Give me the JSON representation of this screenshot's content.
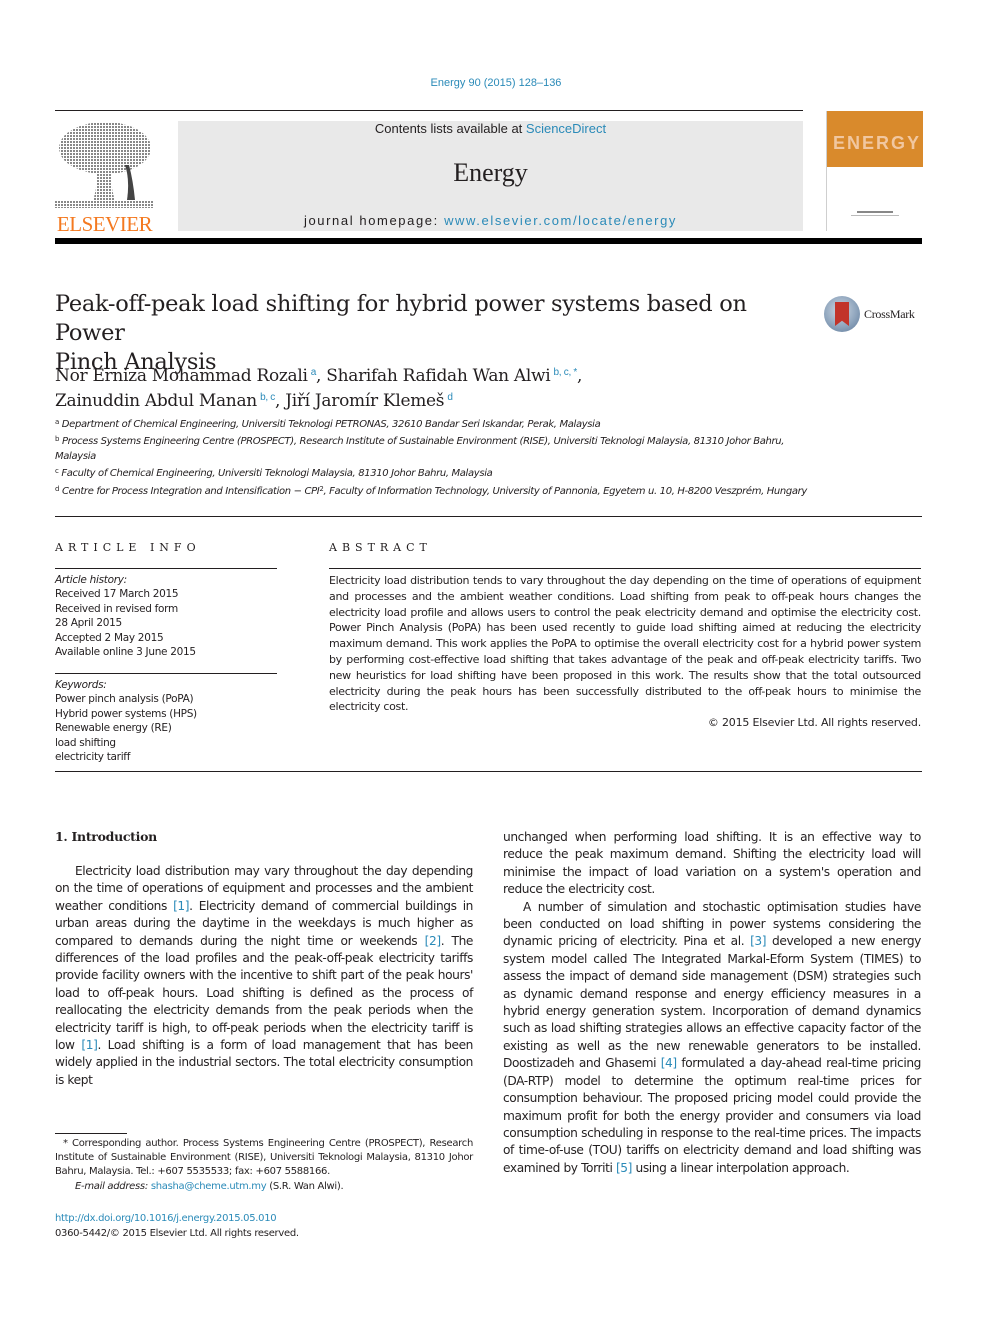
{
  "journal_reference": "Energy 90 (2015) 128–136",
  "header": {
    "publisher_logo_text": "ELSEVIER",
    "contents_prefix": "Contents lists available at ",
    "contents_link": "ScienceDirect",
    "journal_title": "Energy",
    "homepage_prefix": "journal homepage: ",
    "homepage_link": "www.elsevier.com/locate/energy",
    "cover_title": "ENERGY",
    "colors": {
      "link": "#2a8ab8",
      "elsevier_orange": "#f47920",
      "cover_orange": "#d98a2c",
      "banner_bg": "#e9e9e9"
    }
  },
  "article": {
    "title_line1": "Peak-off-peak load shifting for hybrid power systems based on Power",
    "title_line2": "Pinch Analysis",
    "crossmark_label": "CrossMark",
    "authors": [
      {
        "name": "Nor Erniza Mohammad Rozali",
        "sup": "a",
        "sep": ", "
      },
      {
        "name": "Sharifah Rafidah Wan Alwi",
        "sup": "b, c, *",
        "sep": ","
      },
      {
        "name": "Zainuddin Abdul Manan",
        "sup": "b, c",
        "sep": ", "
      },
      {
        "name": "Jiří Jaromír Klemeš",
        "sup": "d",
        "sep": ""
      }
    ],
    "affiliations": [
      {
        "sup": "a",
        "text": "Department of Chemical Engineering, Universiti Teknologi PETRONAS, 32610 Bandar Seri Iskandar, Perak, Malaysia"
      },
      {
        "sup": "b",
        "text": "Process Systems Engineering Centre (PROSPECT), Research Institute of Sustainable Environment (RISE), Universiti Teknologi Malaysia, 81310 Johor Bahru, Malaysia"
      },
      {
        "sup": "c",
        "text": "Faculty of Chemical Engineering, Universiti Teknologi Malaysia, 81310 Johor Bahru, Malaysia"
      },
      {
        "sup": "d",
        "text_before": "Centre for Process Integration and Intensification − CPI",
        "text_sup": "2",
        "text_after": ", Faculty of Information Technology, University of Pannonia, Egyetem u. 10, H-8200 Veszprém, Hungary"
      }
    ]
  },
  "article_info": {
    "heading": "ARTICLE INFO",
    "history_label": "Article history:",
    "history": [
      "Received 17 March 2015",
      "Received in revised form",
      "28 April 2015",
      "Accepted 2 May 2015",
      "Available online 3 June 2015"
    ],
    "keywords_label": "Keywords:",
    "keywords": [
      "Power pinch analysis (PoPA)",
      "Hybrid power systems (HPS)",
      "Renewable energy (RE)",
      "load shifting",
      "electricity tariff"
    ]
  },
  "abstract": {
    "heading": "ABSTRACT",
    "text": "Electricity load distribution tends to vary throughout the day depending on the time of operations of equipment and processes and the ambient weather conditions. Load shifting from peak to off-peak hours changes the electricity load profile and allows users to control the peak electricity demand and optimise the electricity cost. Power Pinch Analysis (PoPA) has been used recently to guide load shifting aimed at reducing the electricity maximum demand. This work applies the PoPA to optimise the overall electricity cost for a hybrid power system by performing cost-effective load shifting that takes advantage of the peak and off-peak electricity tariffs. Two new heuristics for load shifting have been proposed in this work. The results show that the total outsourced electricity during the peak hours has been successfully distributed to the off-peak hours to minimise the electricity cost.",
    "copyright": "© 2015 Elsevier Ltd. All rights reserved."
  },
  "introduction": {
    "heading": "1.  Introduction",
    "left_paragraph": [
      {
        "t": "Electricity load distribution may vary throughout the day depending on the time of operations of equipment and processes and the ambient weather conditions "
      },
      {
        "c": "[1]"
      },
      {
        "t": ". Electricity demand of commercial buildings in urban areas during the daytime in the weekdays is much higher as compared to demands during the night time or weekends "
      },
      {
        "c": "[2]"
      },
      {
        "t": ". The differences of the load profiles and the peak-off-peak electricity tariffs provide facility owners with the incentive to shift part of the peak hours' load to off-peak hours. Load shifting is defined as the process of reallocating the electricity demands from the peak periods when the electricity tariff is high, to off-peak periods when the electricity tariff is low "
      },
      {
        "c": "[1]"
      },
      {
        "t": ". Load shifting is a form of load management that has been widely applied in the industrial sectors. The total electricity consumption is kept"
      }
    ],
    "right_paragraph1": "unchanged when performing load shifting. It is an effective way to reduce the peak maximum demand. Shifting the electricity load will minimise the impact of load variation on a system's operation and reduce the electricity cost.",
    "right_paragraph2": [
      {
        "t": "A number of simulation and stochastic optimisation studies have been conducted on load shifting in power systems considering the dynamic pricing of electricity. Pina et al. "
      },
      {
        "c": "[3]"
      },
      {
        "t": " developed a new energy system model called The Integrated Markal-Eform System (TIMES) to assess the impact of demand side management (DSM) strategies such as dynamic demand response and energy efficiency measures in a hybrid energy generation system. Incorporation of demand dynamics such as load shifting strategies allows an effective capacity factor of the existing as well as the new renewable generators to be installed. Doostizadeh and Ghasemi "
      },
      {
        "c": "[4]"
      },
      {
        "t": " formulated a day-ahead real-time pricing (DA-RTP) model to determine the optimum real-time prices for consumption behaviour. The proposed pricing model could provide the maximum profit for both the energy provider and consumers via load consumption scheduling in response to the real-time prices. The impacts of time-of-use (TOU) tariffs on electricity demand and load shifting was examined by Torriti "
      },
      {
        "c": "[5]"
      },
      {
        "t": " using a linear interpolation approach."
      }
    ]
  },
  "footnotes": {
    "corresponding": "* Corresponding author. Process Systems Engineering Centre (PROSPECT), Research Institute of Sustainable Environment (RISE), Universiti Teknologi Malaysia, 81310 Johor Bahru, Malaysia. Tel.: +607 5535533; fax: +607 5588166.",
    "email_label": "E-mail address:",
    "email": "shasha@cheme.utm.my",
    "email_suffix": " (S.R. Wan Alwi).",
    "doi": "http://dx.doi.org/10.1016/j.energy.2015.05.010",
    "issn_copyright": "0360-5442/© 2015 Elsevier Ltd. All rights reserved."
  }
}
